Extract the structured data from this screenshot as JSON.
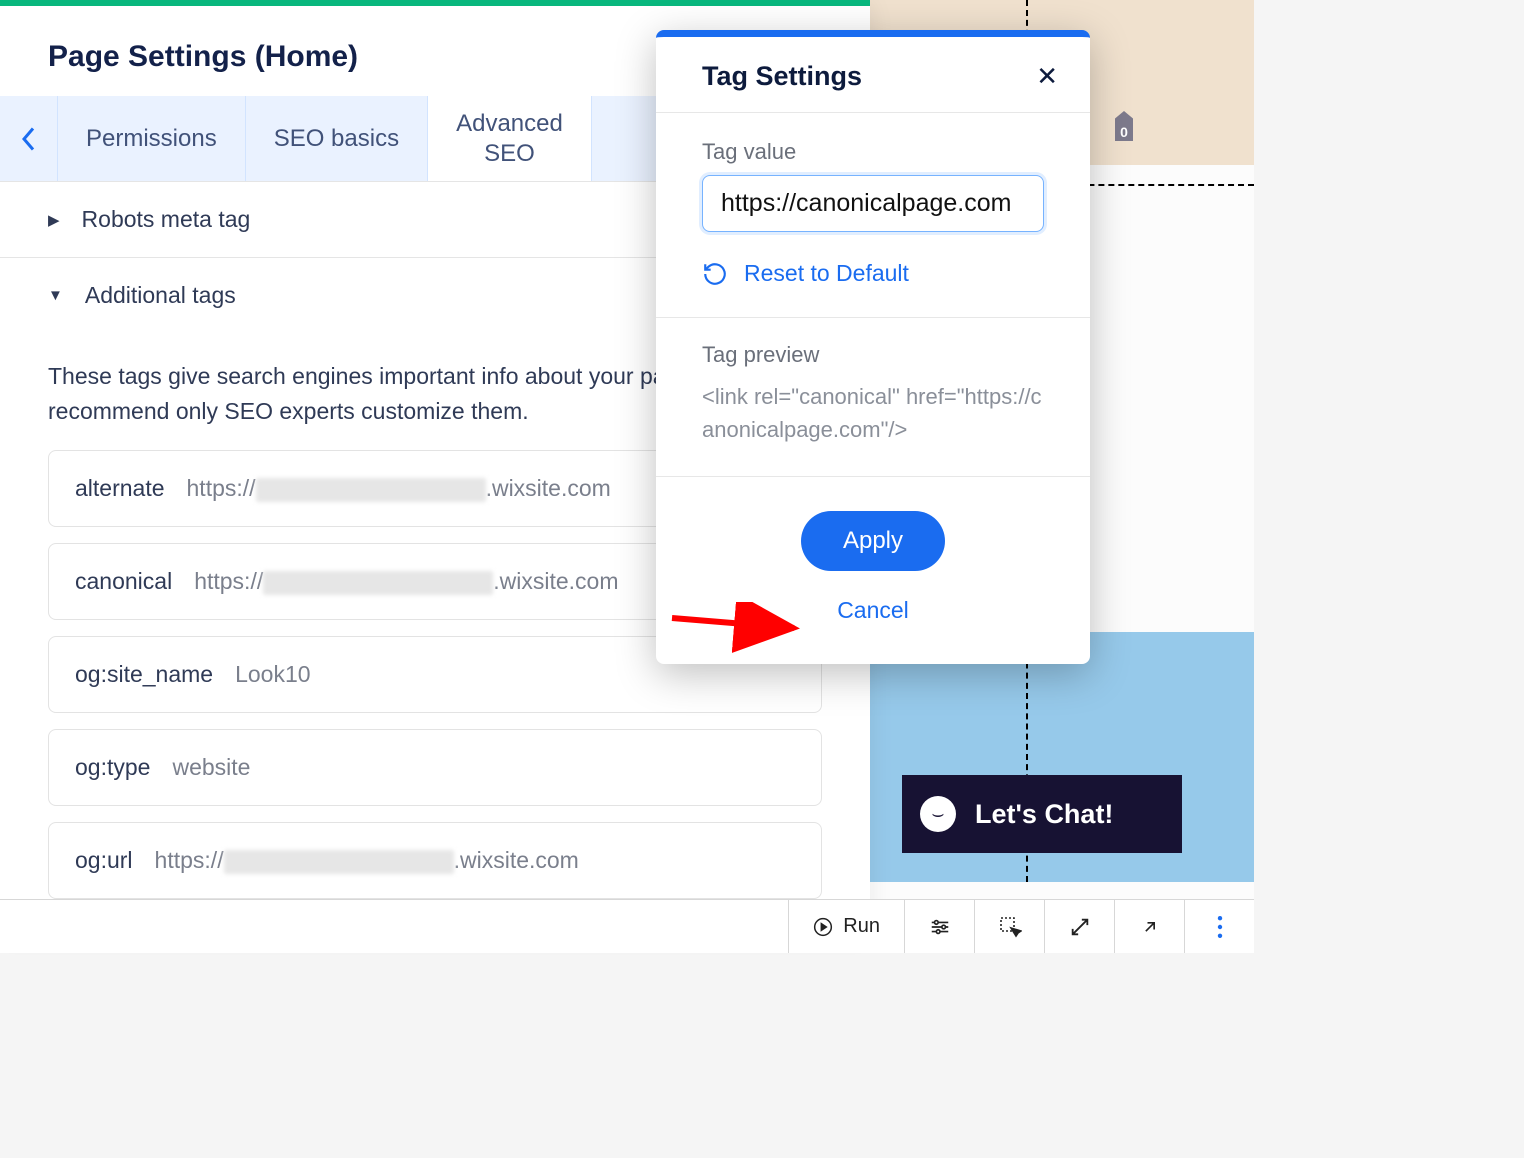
{
  "page_settings": {
    "title": "Page Settings (Home)",
    "tabs": {
      "permissions": "Permissions",
      "seo_basics": "SEO basics",
      "advanced_seo_line1": "Advanced",
      "advanced_seo_line2": "SEO"
    },
    "sections": {
      "robots": "Robots meta tag",
      "additional": "Additional tags"
    },
    "description": "These tags give search engines important info about your pages. We recommend only SEO experts customize them.",
    "tags": [
      {
        "key": "alternate",
        "prefix": "https://",
        "suffix": ".wixsite.com",
        "blurred": true
      },
      {
        "key": "canonical",
        "prefix": "https://",
        "suffix": ".wixsite.com",
        "blurred": true
      },
      {
        "key": "og:site_name",
        "value": "Look10"
      },
      {
        "key": "og:type",
        "value": "website"
      },
      {
        "key": "og:url",
        "prefix": "https://",
        "suffix": ".wixsite.com",
        "blurred": true
      }
    ]
  },
  "modal": {
    "title": "Tag Settings",
    "tag_value_label": "Tag value",
    "tag_value": "https://canonicalpage.com",
    "reset_label": "Reset to Default",
    "preview_label": "Tag preview",
    "preview_code": "<link rel=\"canonical\" href=\"https://canonicalpage.com\"/>",
    "apply": "Apply",
    "cancel": "Cancel"
  },
  "chat": {
    "text": "Let's Chat!",
    "face": "⌣"
  },
  "shopping_bag": {
    "count": "0"
  },
  "bottom_bar": {
    "run": "Run"
  }
}
